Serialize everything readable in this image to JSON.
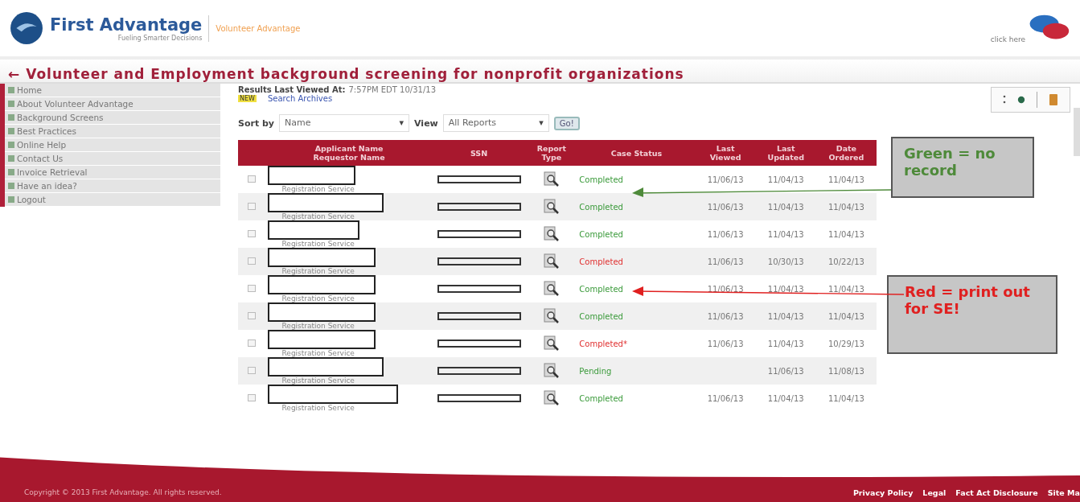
{
  "header": {
    "brand": "First Advantage",
    "tagline": "Fueling Smarter Decisions",
    "product": "Volunteer Advantage",
    "chat_link": "click here"
  },
  "banner": {
    "arrow": "←",
    "title": "Volunteer and Employment background screening for nonprofit organizations"
  },
  "sidebar": {
    "items": [
      {
        "label": "Home"
      },
      {
        "label": "About Volunteer Advantage"
      },
      {
        "label": "Background Screens"
      },
      {
        "label": "Best Practices"
      },
      {
        "label": "Online Help"
      },
      {
        "label": "Contact Us"
      },
      {
        "label": "Invoice Retrieval"
      },
      {
        "label": "Have an idea?"
      },
      {
        "label": "Logout"
      }
    ]
  },
  "results": {
    "label": "Results Last Viewed At:",
    "value": "7:57PM EDT 10/31/13",
    "new_badge": "NEW",
    "archive_link": "Search Archives"
  },
  "filters": {
    "sort_label": "Sort by",
    "sort_value": "Name",
    "view_label": "View",
    "view_value": "All Reports",
    "go_button": "Go!",
    "dropdown_caret": "▾"
  },
  "table": {
    "columns": [
      {
        "line1": "Applicant Name",
        "line2": "Requestor Name"
      },
      {
        "line1": "SSN"
      },
      {
        "line1": "Report",
        "line2": "Type"
      },
      {
        "line1": "Case Status"
      },
      {
        "line1": "Last",
        "line2": "Viewed"
      },
      {
        "line1": "Last",
        "line2": "Updated"
      },
      {
        "line1": "Date",
        "line2": "Ordered"
      }
    ],
    "rows": [
      {
        "checked": false,
        "requestor": "Registration Service",
        "status": "Completed",
        "color": "#3a9a3a",
        "last_viewed": "11/06/13",
        "last_updated": "11/04/13",
        "date_ordered": "11/04/13"
      },
      {
        "checked": false,
        "requestor": "Registration Service",
        "status": "Completed",
        "color": "#3a9a3a",
        "last_viewed": "11/06/13",
        "last_updated": "11/04/13",
        "date_ordered": "11/04/13"
      },
      {
        "checked": false,
        "requestor": "Registration Service",
        "status": "Completed",
        "color": "#3a9a3a",
        "last_viewed": "11/06/13",
        "last_updated": "11/04/13",
        "date_ordered": "11/04/13"
      },
      {
        "checked": false,
        "requestor": "Registration Service",
        "status": "Completed",
        "color": "#e03030",
        "last_viewed": "11/06/13",
        "last_updated": "10/30/13",
        "date_ordered": "10/22/13"
      },
      {
        "checked": false,
        "requestor": "Registration Service",
        "status": "Completed",
        "color": "#3a9a3a",
        "last_viewed": "11/06/13",
        "last_updated": "11/04/13",
        "date_ordered": "11/04/13"
      },
      {
        "checked": false,
        "requestor": "Registration Service",
        "status": "Completed",
        "color": "#3a9a3a",
        "last_viewed": "11/06/13",
        "last_updated": "11/04/13",
        "date_ordered": "11/04/13"
      },
      {
        "checked": false,
        "requestor": "Registration Service",
        "status": "Completed*",
        "color": "#e03030",
        "last_viewed": "11/06/13",
        "last_updated": "11/04/13",
        "date_ordered": "10/29/13"
      },
      {
        "checked": false,
        "requestor": "Registration Service",
        "status": "Pending",
        "color": "#3a9a3a",
        "last_updated": "11/06/13",
        "date_ordered": "11/08/13"
      },
      {
        "checked": false,
        "requestor": "Registration Service",
        "status": "Completed",
        "color": "#3a9a3a",
        "last_viewed": "11/06/13",
        "last_updated": "11/04/13",
        "date_ordered": "11/04/13"
      }
    ]
  },
  "callouts": [
    {
      "text": "Green = no record",
      "color": "#4e8a3a"
    },
    {
      "text": "Red = print out for SE!",
      "color": "#e02020"
    }
  ],
  "footer": {
    "copyright": "Copyright © 2013 First Advantage. All rights reserved.",
    "links": [
      "Privacy Policy",
      "Legal",
      "Fact Act Disclosure",
      "Site Ma"
    ]
  }
}
